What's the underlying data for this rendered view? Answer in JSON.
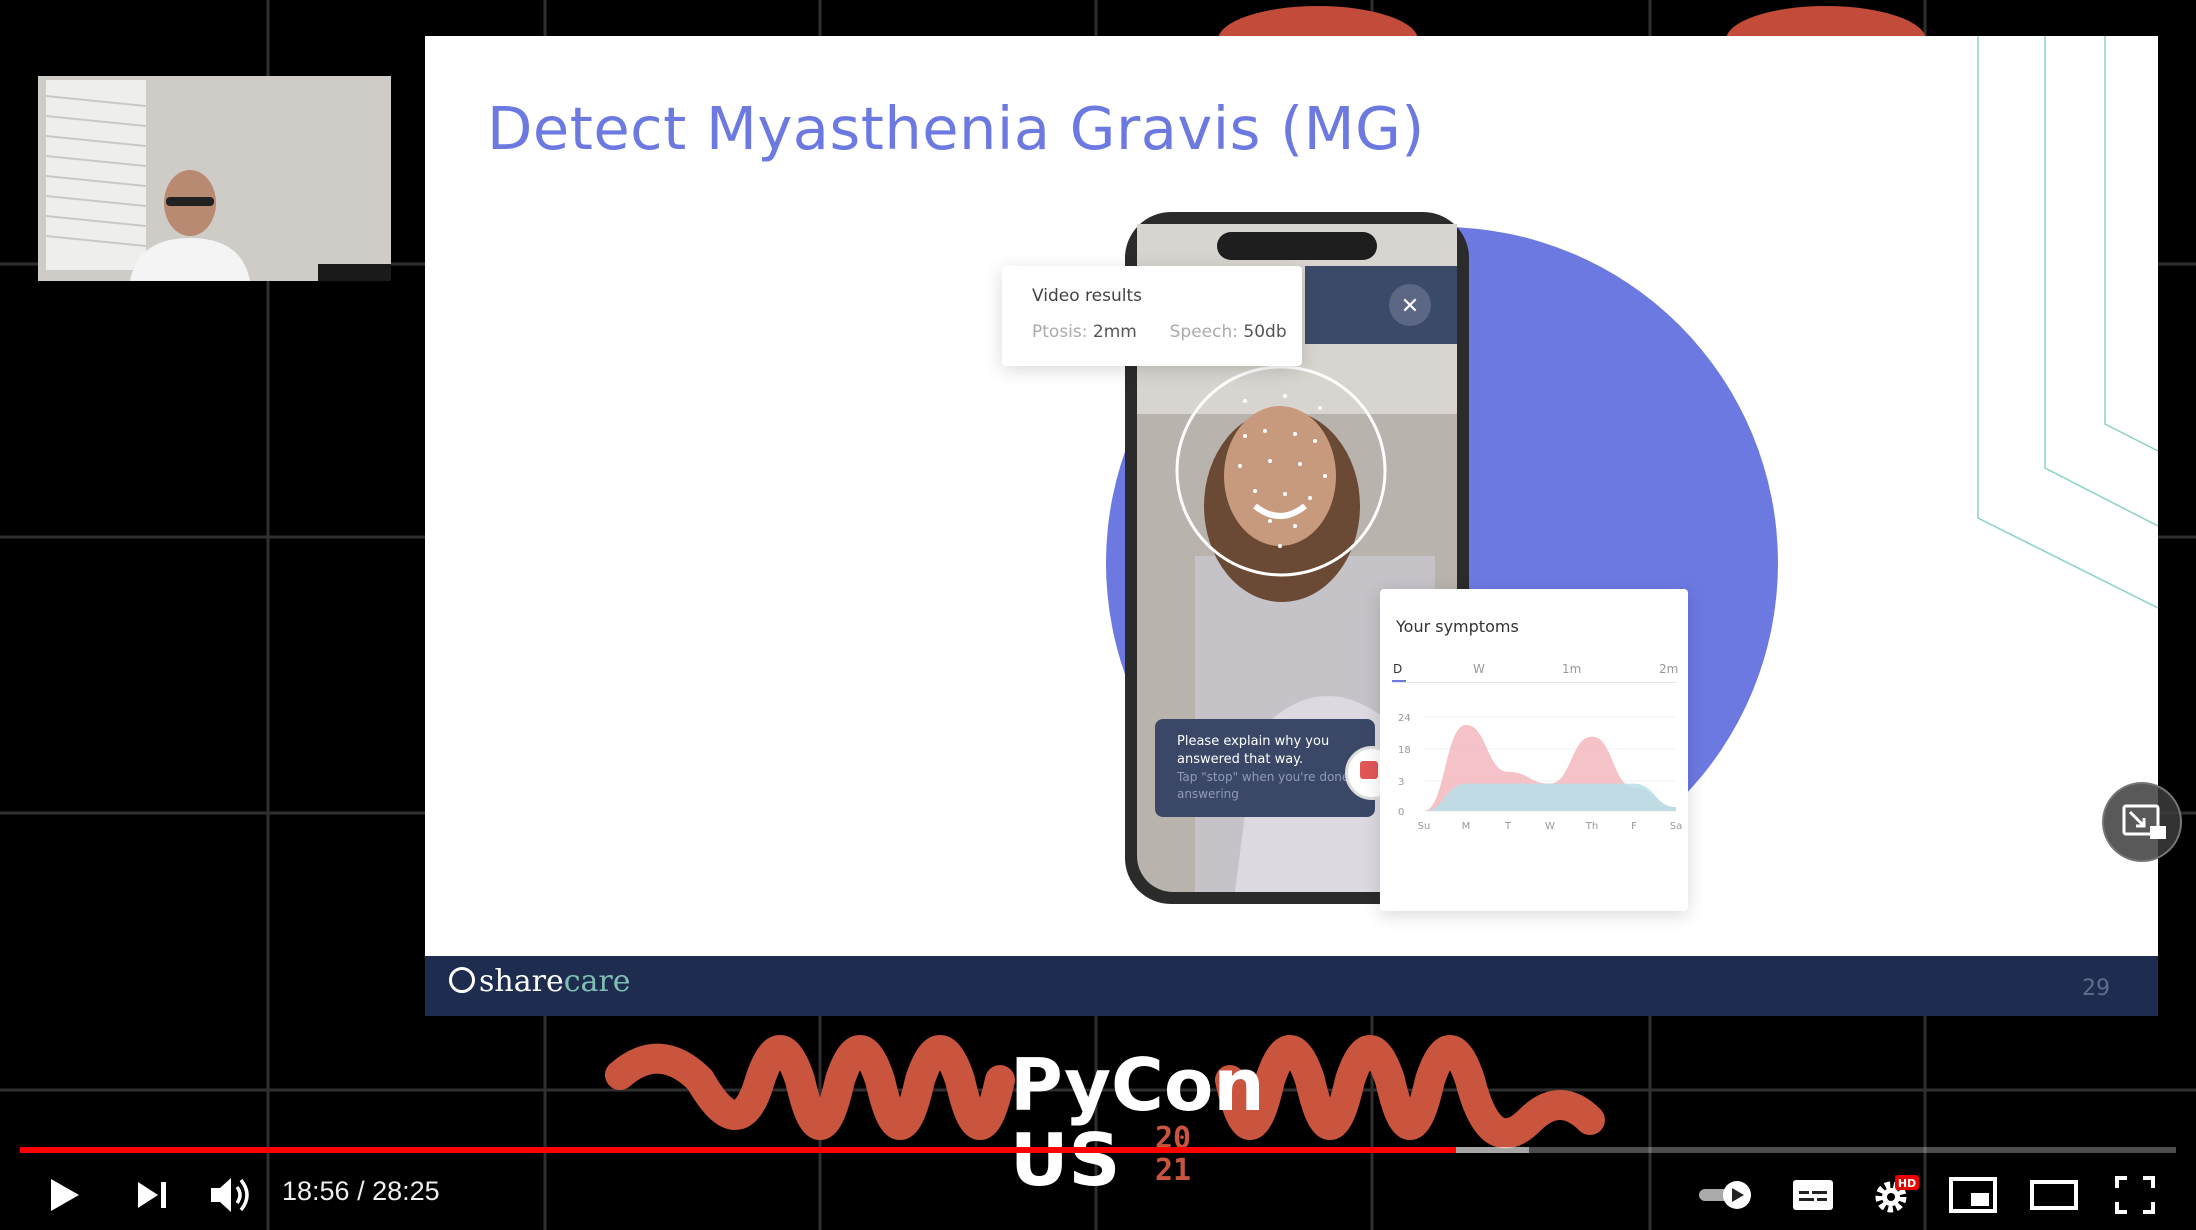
{
  "slide": {
    "title": "Detect Myasthenia Gravis (MG)",
    "brand_prefix": "share",
    "brand_suffix": "care",
    "page_number": "29"
  },
  "video_results": {
    "title": "Video results",
    "ptosis_label": "Ptosis:",
    "ptosis_value": "2mm",
    "speech_label": "Speech:",
    "speech_value": "50db"
  },
  "prompt": {
    "line1": "Please explain why you answered that way.",
    "line2": "Tap \"stop\" when you're done answering"
  },
  "symptoms": {
    "title": "Your symptoms",
    "tabs": [
      "D",
      "W",
      "1m",
      "2m"
    ]
  },
  "chart_data": {
    "type": "area",
    "title": "Your symptoms",
    "categories": [
      "Su",
      "M",
      "T",
      "W",
      "Th",
      "F",
      "Sa"
    ],
    "y_ticks": [
      "24",
      "18",
      "3",
      "0"
    ],
    "series": [
      {
        "values": [
          0,
          22,
          10,
          7,
          19,
          6,
          1
        ],
        "color": "#f3b7bd"
      },
      {
        "values": [
          0,
          7,
          7,
          7,
          7,
          7,
          1
        ],
        "color": "#b7dfea"
      }
    ]
  },
  "player": {
    "time_current": "18:56",
    "time_separator": " / ",
    "time_total": "28:25",
    "progress": 0.666,
    "hd_badge": "HD",
    "accent_color": "#ff0000"
  },
  "banner": {
    "line1": "PyCon",
    "line2": "US",
    "year_top": "20",
    "year_bottom": "21"
  }
}
